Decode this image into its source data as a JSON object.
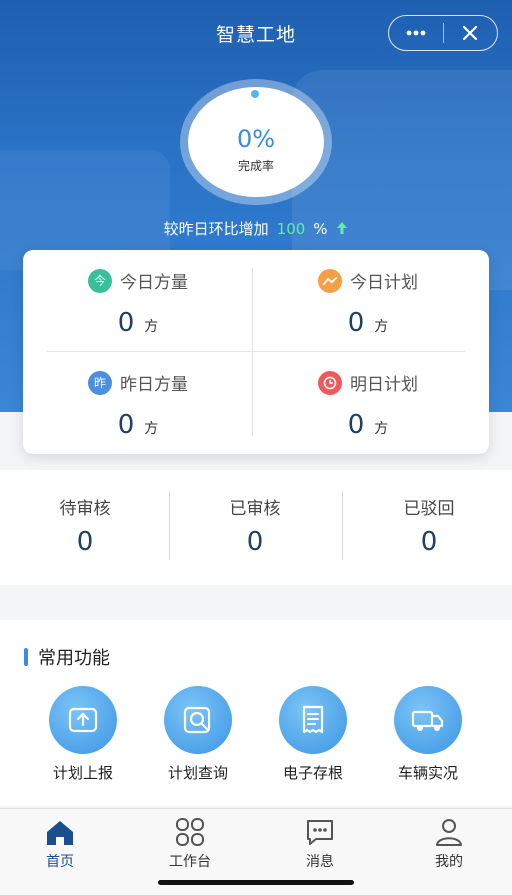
{
  "header": {
    "title": "智慧工地",
    "more_icon": "more-icon",
    "close_icon": "close-icon"
  },
  "progress": {
    "percent_text": "0%",
    "label": "完成率",
    "value": 0
  },
  "compare": {
    "prefix": "较昨日环比增加",
    "value": "100",
    "suffix": "%",
    "trend_icon": "arrow-up-icon",
    "trend_color": "#5df0a0"
  },
  "stats": [
    {
      "icon_text": "今",
      "icon_color": "#3bbf9a",
      "label": "今日方量",
      "value": "0",
      "unit": "方"
    },
    {
      "icon_text": "~",
      "icon_color": "#f5a046",
      "label": "今日计划",
      "value": "0",
      "unit": "方"
    },
    {
      "icon_text": "昨",
      "icon_color": "#4d8fdf",
      "label": "昨日方量",
      "value": "0",
      "unit": "方"
    },
    {
      "icon_text": "◷",
      "icon_color": "#ee5a5a",
      "label": "明日计划",
      "value": "0",
      "unit": "方"
    }
  ],
  "audit": [
    {
      "label": "待审核",
      "value": "0"
    },
    {
      "label": "已审核",
      "value": "0"
    },
    {
      "label": "已驳回",
      "value": "0"
    }
  ],
  "functions": {
    "title": "常用功能",
    "items": [
      {
        "label": "计划上报",
        "icon": "upload-icon"
      },
      {
        "label": "计划查询",
        "icon": "search-doc-icon"
      },
      {
        "label": "电子存根",
        "icon": "receipt-icon"
      },
      {
        "label": "车辆实况",
        "icon": "truck-icon"
      }
    ]
  },
  "tabbar": [
    {
      "label": "首页",
      "icon": "home-icon",
      "active": true
    },
    {
      "label": "工作台",
      "icon": "workbench-icon",
      "active": false
    },
    {
      "label": "消息",
      "icon": "message-icon",
      "active": false
    },
    {
      "label": "我的",
      "icon": "user-icon",
      "active": false
    }
  ],
  "colors": {
    "primary": "#2a74c8",
    "accent": "#3b8be0",
    "value_text": "#1f3f66"
  }
}
